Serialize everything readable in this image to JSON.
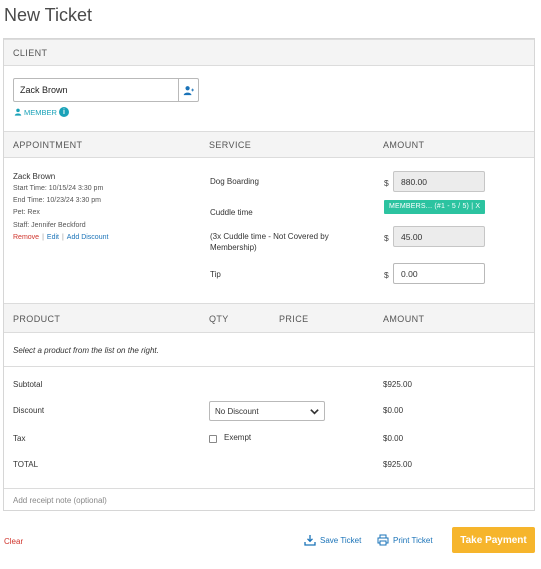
{
  "page": {
    "title": "New Ticket"
  },
  "client": {
    "header": "CLIENT",
    "name": "Zack Brown",
    "badge": "MEMBER",
    "info_icon": "i"
  },
  "appointment": {
    "headers": {
      "appointment": "APPOINTMENT",
      "service": "SERVICE",
      "amount": "AMOUNT"
    },
    "client_name": "Zack Brown",
    "start_time": "Start Time: 10/15/24 3:30 pm",
    "end_time": "End Time: 10/23/24 3:30 pm",
    "pet": "Pet: Rex",
    "staff": "Staff: Jennifer Beckford",
    "links": {
      "remove": "Remove",
      "edit": "Edit",
      "add_discount": "Add Discount",
      "separator": "|"
    },
    "services": {
      "boarding": {
        "name": "Dog Boarding",
        "currency": "$",
        "amount": "880.00"
      },
      "cuddle": {
        "name": "Cuddle time",
        "pill": "MEMBERS... (#1 - 5 / 5) | X"
      },
      "cuddle_extra": {
        "name": "(3x Cuddle time - Not Covered by Membership)",
        "currency": "$",
        "amount": "45.00"
      },
      "tip": {
        "name": "Tip",
        "currency": "$",
        "amount": "0.00"
      }
    }
  },
  "products": {
    "headers": {
      "product": "PRODUCT",
      "qty": "QTY",
      "price": "PRICE",
      "amount": "AMOUNT"
    },
    "empty_text": "Select a product from the list on the right."
  },
  "totals": {
    "subtotal_label": "Subtotal",
    "subtotal": "$925.00",
    "discount_label": "Discount",
    "discount_select": "No Discount",
    "discount": "$0.00",
    "tax_label": "Tax",
    "exempt_label": "Exempt",
    "tax": "$0.00",
    "total_label": "TOTAL",
    "total": "$925.00"
  },
  "receipt": {
    "placeholder": "Add receipt note (optional)"
  },
  "footer": {
    "clear": "Clear",
    "save_ticket": "Save Ticket",
    "print_ticket": "Print Ticket",
    "take_payment": "Take Payment"
  },
  "colors": {
    "accent": "#1a73b8",
    "member": "#1aa2b8",
    "pill": "#2cc3a0",
    "cta": "#f6b52c",
    "danger": "#d0342c"
  }
}
